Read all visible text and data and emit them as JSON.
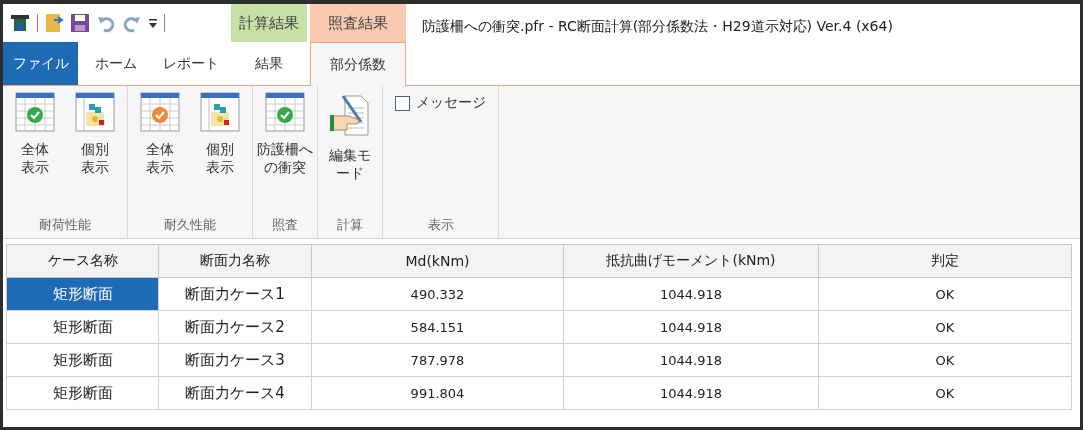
{
  "window": {
    "title": "防護柵への衝突.pfr - RC断面計算(部分係数法・H29道示対応) Ver.4 (x64)"
  },
  "tabs": [
    {
      "label": "ファイル",
      "kind": "file",
      "selected": false
    },
    {
      "label": "ホーム",
      "kind": "plain",
      "selected": false
    },
    {
      "label": "レポート",
      "kind": "plain",
      "selected": false
    }
  ],
  "context_groups": [
    {
      "label": "計算結果",
      "color": "#c6e0a8",
      "tabs": [
        {
          "label": "結果",
          "selected": false
        }
      ]
    },
    {
      "label": "照査結果",
      "color": "#f9c9b0",
      "tabs": [
        {
          "label": "部分係数",
          "selected": true
        }
      ]
    }
  ],
  "ribbon": {
    "groups": [
      {
        "label": "耐荷性能",
        "buttons": [
          {
            "label": "全体表示",
            "kind": "overview",
            "color": "#3aa84a"
          },
          {
            "label": "個別表示",
            "kind": "detail"
          }
        ]
      },
      {
        "label": "耐久性能",
        "buttons": [
          {
            "label": "全体表示",
            "kind": "overview",
            "color": "#ef8a3c"
          },
          {
            "label": "個別表示",
            "kind": "detail"
          }
        ]
      },
      {
        "label": "照査",
        "buttons": [
          {
            "label": "防護柵への衝突",
            "kind": "overview",
            "color": "#3aa84a"
          }
        ]
      },
      {
        "label": "計算",
        "buttons": [
          {
            "label": "編集モード",
            "kind": "edit"
          }
        ]
      },
      {
        "label": "表示",
        "checkbox": {
          "label": "メッセージ",
          "checked": false
        }
      }
    ]
  },
  "table": {
    "columns": [
      "ケース名称",
      "断面力名称",
      "Md(kNm)",
      "抵抗曲げモーメント(kNm)",
      "判定"
    ],
    "rows": [
      {
        "selected": true,
        "cells": [
          "矩形断面",
          "断面力ケース1",
          "490.332",
          "1044.918",
          "OK"
        ]
      },
      {
        "selected": false,
        "cells": [
          "矩形断面",
          "断面力ケース2",
          "584.151",
          "1044.918",
          "OK"
        ]
      },
      {
        "selected": false,
        "cells": [
          "矩形断面",
          "断面力ケース3",
          "787.978",
          "1044.918",
          "OK"
        ]
      },
      {
        "selected": false,
        "cells": [
          "矩形断面",
          "断面力ケース4",
          "991.804",
          "1044.918",
          "OK"
        ]
      }
    ]
  }
}
